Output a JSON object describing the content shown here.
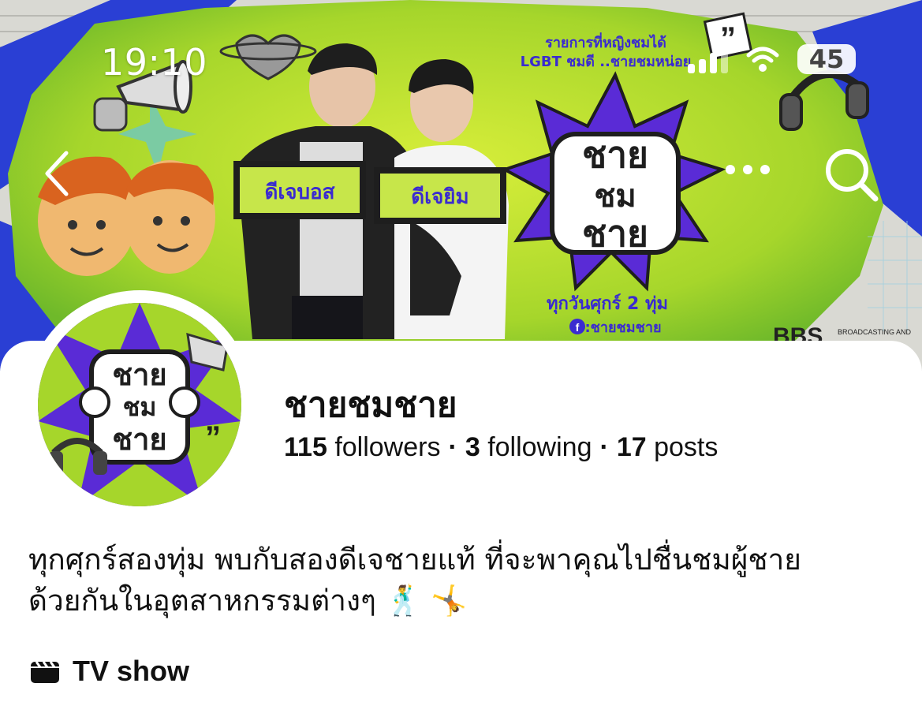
{
  "status_bar": {
    "time": "19:10",
    "battery": "45"
  },
  "nav": {
    "back_icon": "chevron-left-icon",
    "more_icon": "more-horizontal-icon",
    "search_icon": "search-icon"
  },
  "cover": {
    "tagline_line1": "รายการที่หญิงชมได้",
    "tagline_line2": "LGBT ชมดี ..ชายชมหน่อย",
    "host1_sign": "ดีเจบอส",
    "host2_sign": "ดีเจยิม",
    "logo_line1": "ชาย",
    "logo_line2": "ชม",
    "logo_line3": "ชาย",
    "schedule": "ทุกวันศุกร์ 2 ทุ่ม",
    "facebook_handle": ":ชายชมชาย",
    "broadcaster": "BROADCASTING AND"
  },
  "profile": {
    "name": "ชายชมชาย",
    "followers_count": "115",
    "followers_label": "followers",
    "following_count": "3",
    "following_label": "following",
    "posts_count": "17",
    "posts_label": "posts",
    "separator": "·",
    "bio_line1": "ทุกศุกร์สองทุ่ม พบกับสองดีเจชายแท้ ที่จะพาคุณไปชื่นชมผู้ชาย",
    "bio_line2": "ด้วยกันในอุตสาหกรรมต่างๆ 🕺 🤸",
    "category_icon": "clapperboard-icon",
    "category": "TV show"
  },
  "colors": {
    "cover_green": "#a6d62b",
    "cover_purple": "#5a2bd6",
    "cover_blue": "#2a3fd4",
    "text": "#111111"
  }
}
